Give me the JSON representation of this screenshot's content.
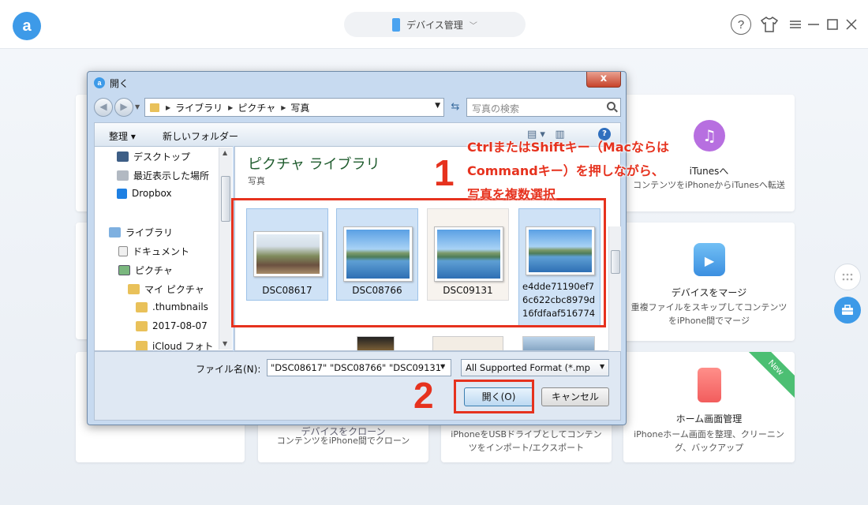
{
  "app": {
    "logo_letter": "a",
    "device_selector": "デバイス管理",
    "help_glyph": "?"
  },
  "cards": [
    {
      "title": "iTunesへ",
      "desc": "コンテンツをiPhoneからiTunesへ転送",
      "icon_color": "#b76fe0"
    },
    {
      "title": "デバイスをマージ",
      "desc": "重複ファイルをスキップしてコンテンツをiPhone間でマージ",
      "icon_color": "#4fa3e8"
    },
    {
      "title": "ホーム画面管理",
      "desc": "iPhoneホーム画面を整理、クリーニング、バックアップ",
      "icon_color": "#f26d6d",
      "badge": "New"
    },
    {
      "title": "デバイスをクローン",
      "desc": "コンテンツをiPhone間でクローン"
    },
    {
      "title": "",
      "desc": "iPhoneをUSBドライブとしてコンテンツをインポート/エクスポート"
    }
  ],
  "dialog": {
    "title": "開く",
    "close_glyph": "x",
    "breadcrumbs": [
      "ライブラリ",
      "ピクチャ",
      "写真"
    ],
    "search_placeholder": "写真の検索",
    "toolbar": {
      "organize": "整理 ▾",
      "new_folder": "新しいフォルダー"
    },
    "nav_items": [
      {
        "label": "デスクトップ",
        "icon": "desktop-icon"
      },
      {
        "label": "最近表示した場所",
        "icon": "recent-places-icon"
      },
      {
        "label": "Dropbox",
        "icon": "dropbox-icon"
      },
      {
        "label": "ライブラリ",
        "icon": "library-icon"
      },
      {
        "label": "ドキュメント",
        "icon": "document-icon"
      },
      {
        "label": "ピクチャ",
        "icon": "pictures-icon"
      },
      {
        "label": "マイ ピクチャ",
        "icon": "folder-icon"
      },
      {
        "label": ".thumbnails",
        "icon": "folder-icon"
      },
      {
        "label": "2017-08-07",
        "icon": "folder-icon"
      },
      {
        "label": "iCloud フォト",
        "icon": "folder-icon"
      }
    ],
    "library_title": "ピクチャ ライブラリ",
    "library_sub": "写真",
    "files": [
      {
        "name": "DSC08617",
        "selected": true
      },
      {
        "name": "DSC08766",
        "selected": true
      },
      {
        "name": "DSC09131",
        "selected": false
      },
      {
        "name": "e4dde71190ef76c622cbc8979d16fdfaaf516774",
        "selected": true
      }
    ],
    "file_name_label": "ファイル名(N):",
    "file_name_value": "\"DSC08617\" \"DSC08766\" \"DSC09131\"",
    "file_type": "All Supported Format (*.mp",
    "open_button": "開く(O)",
    "cancel_button": "キャンセル"
  },
  "annotations": {
    "step1": "1",
    "step2": "2",
    "note": "CtrlまたはShiftキー（MacならはCommandキー）を押しながら、写真を複数選択",
    "color": "#e6321e"
  }
}
